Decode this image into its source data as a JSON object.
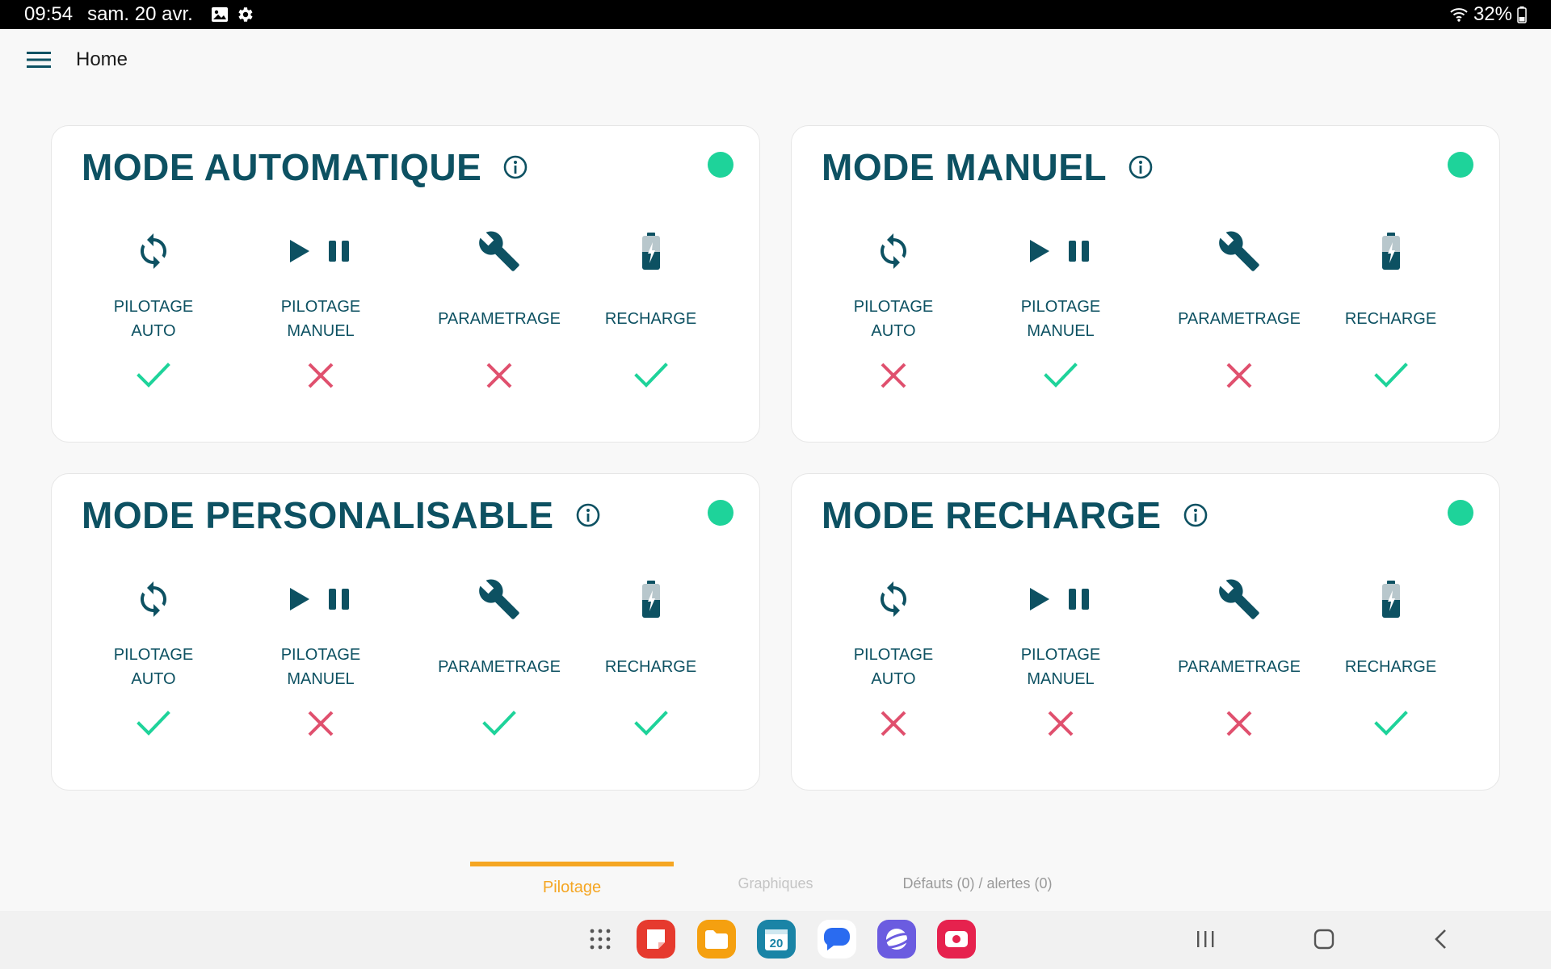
{
  "status_bar": {
    "time": "09:54",
    "date": "sam. 20 avr.",
    "battery": "32%"
  },
  "app_bar": {
    "title": "Home"
  },
  "colors": {
    "title": "#0d5162",
    "ok": "#1ed39a",
    "ko": "#e0506e",
    "active_tab": "#f5a623"
  },
  "cards": [
    {
      "title": "MODE AUTOMATIQUE",
      "status": "active",
      "features": [
        {
          "label": "PILOTAGE\nAUTO",
          "icon": "sync-icon",
          "state": "ok"
        },
        {
          "label": "PILOTAGE\nMANUEL",
          "icon": "play-pause-icon",
          "state": "ko"
        },
        {
          "label": "PARAMETRAGE",
          "icon": "wrench-icon",
          "state": "ko"
        },
        {
          "label": "RECHARGE",
          "icon": "battery-charging-icon",
          "state": "ok"
        }
      ]
    },
    {
      "title": "MODE MANUEL",
      "status": "active",
      "features": [
        {
          "label": "PILOTAGE\nAUTO",
          "icon": "sync-icon",
          "state": "ko"
        },
        {
          "label": "PILOTAGE\nMANUEL",
          "icon": "play-pause-icon",
          "state": "ok"
        },
        {
          "label": "PARAMETRAGE",
          "icon": "wrench-icon",
          "state": "ko"
        },
        {
          "label": "RECHARGE",
          "icon": "battery-charging-icon",
          "state": "ok"
        }
      ]
    },
    {
      "title": "MODE PERSONALISABLE",
      "status": "active",
      "features": [
        {
          "label": "PILOTAGE\nAUTO",
          "icon": "sync-icon",
          "state": "ok"
        },
        {
          "label": "PILOTAGE\nMANUEL",
          "icon": "play-pause-icon",
          "state": "ko"
        },
        {
          "label": "PARAMETRAGE",
          "icon": "wrench-icon",
          "state": "ok"
        },
        {
          "label": "RECHARGE",
          "icon": "battery-charging-icon",
          "state": "ok"
        }
      ]
    },
    {
      "title": "MODE RECHARGE",
      "status": "active",
      "features": [
        {
          "label": "PILOTAGE\nAUTO",
          "icon": "sync-icon",
          "state": "ko"
        },
        {
          "label": "PILOTAGE\nMANUEL",
          "icon": "play-pause-icon",
          "state": "ko"
        },
        {
          "label": "PARAMETRAGE",
          "icon": "wrench-icon",
          "state": "ko"
        },
        {
          "label": "RECHARGE",
          "icon": "battery-charging-icon",
          "state": "ok"
        }
      ]
    }
  ],
  "tabs": [
    {
      "label": "Pilotage",
      "active": true
    },
    {
      "label": "Graphiques",
      "active": false
    },
    {
      "label": "Défauts (0) / alertes (0)",
      "active": false
    }
  ],
  "nav_bar": {
    "apps": [
      "app-drawer-icon",
      "notes-app-icon",
      "files-app-icon",
      "calendar-app-icon",
      "messages-app-icon",
      "internet-app-icon",
      "screen-recorder-app-icon"
    ],
    "calendar_day": "20",
    "buttons": [
      "recents-button",
      "home-button",
      "back-button"
    ]
  }
}
